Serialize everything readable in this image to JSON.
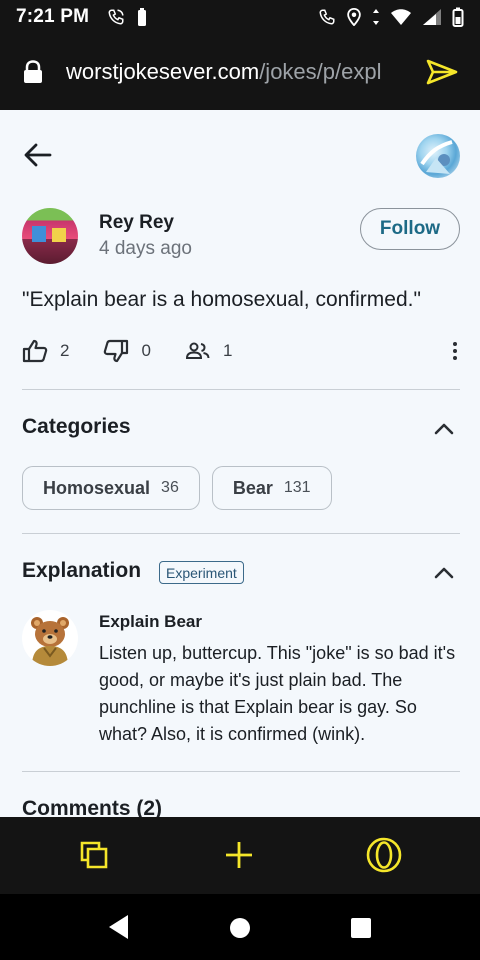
{
  "status": {
    "time": "7:21 PM"
  },
  "browser": {
    "url_domain": "worstjokesever.com",
    "url_path": "/jokes/p/expl"
  },
  "post": {
    "author_name": "Rey Rey",
    "time_ago": "4 days ago",
    "follow_label": "Follow",
    "joke_text": "\"Explain bear is a homosexual, confirmed.\"",
    "likes": "2",
    "dislikes": "0",
    "followers": "1"
  },
  "categories": {
    "title": "Categories",
    "items": [
      {
        "label": "Homosexual",
        "count": "36"
      },
      {
        "label": "Bear",
        "count": "131"
      }
    ]
  },
  "explanation": {
    "title": "Explanation",
    "badge": "Experiment",
    "author": "Explain Bear",
    "text": "Listen up, buttercup. This \"joke\" is so bad it's good, or maybe it's just plain bad. The punchline is that Explain bear is gay. So what? Also, it is confirmed (wink)."
  },
  "comments": {
    "title": "Comments (2)"
  },
  "colors": {
    "accent_yellow": "#f5e62a",
    "follow_text": "#1d6a86",
    "bar_bg": "#141414"
  },
  "icons": [
    "back-arrow-icon",
    "send-icon",
    "lock-icon",
    "thumbs-up-icon",
    "thumbs-down-icon",
    "people-icon",
    "more-vert-icon",
    "chevron-up-icon",
    "tabs-icon",
    "plus-icon",
    "opera-icon"
  ]
}
